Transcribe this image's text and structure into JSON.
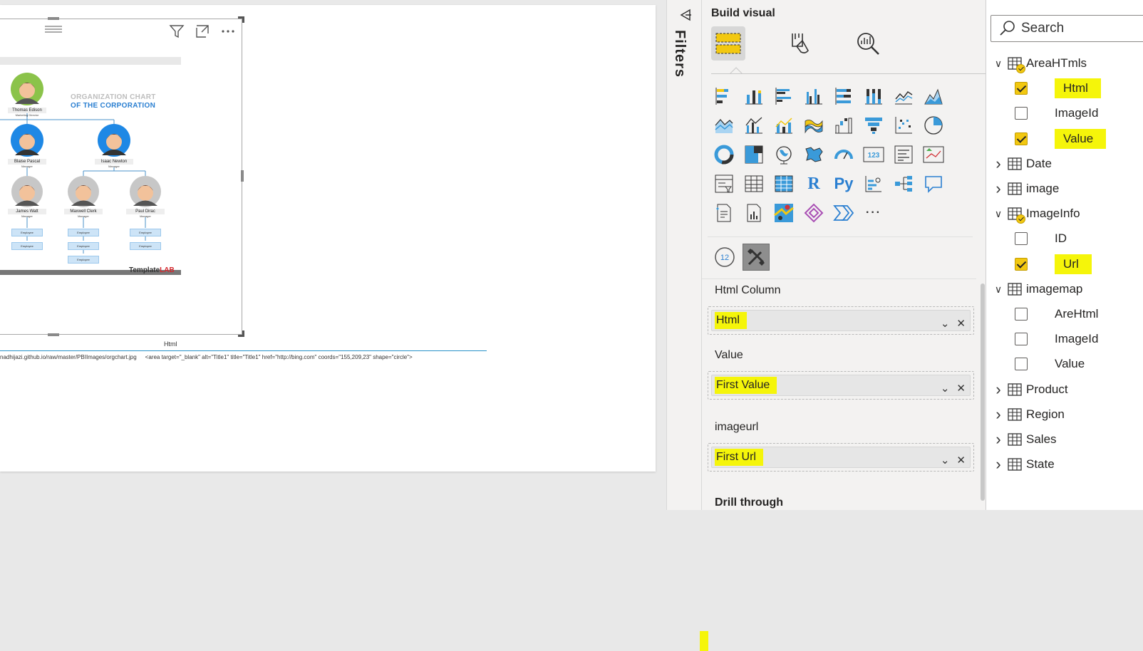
{
  "canvas": {
    "org_chart": {
      "title_line1": "ORGANIZATION CHART",
      "title_line2": "OF THE CORPORATION",
      "top": {
        "name": "Thomas Edison",
        "role": "Marketing Director"
      },
      "managers": [
        {
          "name": "Blaise Pascal",
          "role": "Manager"
        },
        {
          "name": "Isaac Newton",
          "role": "Manager"
        }
      ],
      "staff": [
        {
          "name": "James Watt",
          "role": "Manager"
        },
        {
          "name": "Maxwell Clerk",
          "role": "Manager"
        },
        {
          "name": "Paul Dirac",
          "role": "Manager"
        }
      ],
      "employee_label": "Employee",
      "logo_main": "Template",
      "logo_accent": "LAB"
    },
    "table": {
      "header": "Html",
      "row_url": "nadhijazi.github.io/raw/master/PBIImages/orgchart.jpg",
      "row_html": "<area target=\"_blank\" alt=\"Title1\" title=\"Title1\" href=\"http://bing.com\" coords=\"155,209,23\" shape=\"circle\">"
    }
  },
  "filters": {
    "label": "Filters"
  },
  "viz_pane": {
    "title": "Build visual",
    "tabs": [
      "build-visual-icon",
      "format-visual-icon",
      "analytics-icon"
    ],
    "wells": [
      {
        "label": "Html Column",
        "value": "Html"
      },
      {
        "label": "Value",
        "value": "First Value"
      },
      {
        "label": "imageurl",
        "value": "First Url"
      }
    ],
    "drill_label": "Drill through",
    "more_label": "···",
    "r_label": "R",
    "py_label": "Py",
    "num_label": "123",
    "badge_label": "12"
  },
  "fields_pane": {
    "search_placeholder": "Search",
    "tables": [
      {
        "name": "AreaHTmls",
        "expanded": true,
        "badge": true,
        "fields": [
          {
            "name": "Html",
            "checked": true
          },
          {
            "name": "ImageId",
            "checked": false
          },
          {
            "name": "Value",
            "checked": true
          }
        ]
      },
      {
        "name": "Date",
        "expanded": false,
        "badge": false,
        "fields": []
      },
      {
        "name": "image",
        "expanded": false,
        "badge": false,
        "fields": []
      },
      {
        "name": "ImageInfo",
        "expanded": true,
        "badge": true,
        "fields": [
          {
            "name": "ID",
            "checked": false
          },
          {
            "name": "Url",
            "checked": true
          }
        ]
      },
      {
        "name": "imagemap",
        "expanded": true,
        "badge": false,
        "fields": [
          {
            "name": "AreHtml",
            "checked": false
          },
          {
            "name": "ImageId",
            "checked": false
          },
          {
            "name": "Value",
            "checked": false
          }
        ]
      },
      {
        "name": "Product",
        "expanded": false,
        "badge": false,
        "fields": []
      },
      {
        "name": "Region",
        "expanded": false,
        "badge": false,
        "fields": []
      },
      {
        "name": "Sales",
        "expanded": false,
        "badge": false,
        "fields": []
      },
      {
        "name": "State",
        "expanded": false,
        "badge": false,
        "fields": []
      }
    ]
  },
  "colors": {
    "accent_yellow": "#f2c811",
    "highlight": "#f5f50a",
    "org_blue": "#2a7fd1",
    "table_line": "#2a92c8"
  }
}
